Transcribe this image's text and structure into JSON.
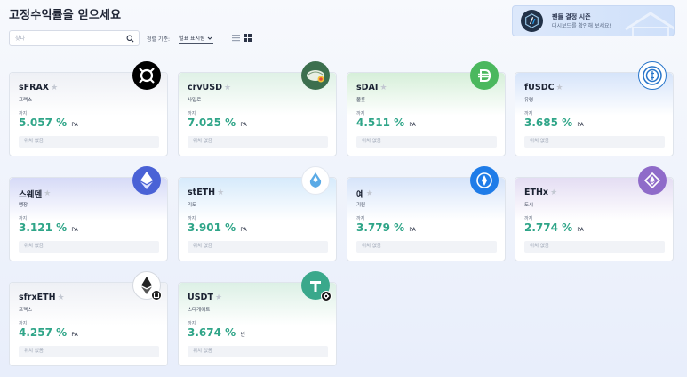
{
  "page": {
    "title": "고정수익률을 얻으세요"
  },
  "banner": {
    "title": "펜들 결정 시즌",
    "subtitle": "대시보드를 확인해 보세요!"
  },
  "toolbar": {
    "search_placeholder": "찾다",
    "sort_label": "정렬 기준:",
    "sort_value": "별표 표시됨"
  },
  "colors": {
    "rate_green": "#2fa588",
    "sfrax_head": "#eef0f5",
    "crvusd_head": "#dff1e6",
    "sdai_head": "#d9f0dd",
    "fusdc_head": "#d8e6fa",
    "weth_head": "#d9dcf7",
    "steth_head": "#d9ecfb",
    "usde_head": "#d8e6fa",
    "ethx_head": "#e6e0f3",
    "sfrxeth_head": "#eef0f5",
    "usdt_head": "#dff1e8"
  },
  "cards": [
    {
      "name": "sFRAX",
      "sub": "프랙스",
      "until": "까지",
      "rate": "5.057 %",
      "unit": "PA",
      "position": "위치 없음",
      "icon": "frax-icon",
      "badge": ""
    },
    {
      "name": "crvUSD",
      "sub": "사일로",
      "until": "까지",
      "rate": "7.025 %",
      "unit": "PA",
      "position": "위치 없음",
      "icon": "silo-icon",
      "badge": ""
    },
    {
      "name": "sDAI",
      "sub": "볼릇",
      "until": "까지",
      "rate": "4.511 %",
      "unit": "PA",
      "position": "위치 없음",
      "icon": "dai-icon",
      "badge": ""
    },
    {
      "name": "fUSDC",
      "sub": "유령",
      "until": "까지",
      "rate": "3.685 %",
      "unit": "PA",
      "position": "위치 없음",
      "icon": "usdc-icon",
      "badge": ""
    },
    {
      "name": "스웨덴",
      "sub": "맹장",
      "until": "까지",
      "rate": "3.121 %",
      "unit": "PA",
      "position": "위치 없음",
      "icon": "ethereum-icon",
      "badge": ""
    },
    {
      "name": "stETH",
      "sub": "리도",
      "until": "까지",
      "rate": "3.901 %",
      "unit": "PA",
      "position": "위치 없음",
      "icon": "lido-icon",
      "badge": ""
    },
    {
      "name": "예",
      "sub": "기원",
      "until": "까지",
      "rate": "3.779 %",
      "unit": "PA",
      "position": "위치 없음",
      "icon": "usde-icon",
      "badge": ""
    },
    {
      "name": "ETHx",
      "sub": "도시",
      "until": "까지",
      "rate": "2.774 %",
      "unit": "PA",
      "position": "위치 없음",
      "icon": "ethx-icon",
      "badge": ""
    },
    {
      "name": "sfrxETH",
      "sub": "프랙스",
      "until": "까지",
      "rate": "4.257 %",
      "unit": "PA",
      "position": "위치 없음",
      "icon": "sfrxeth-icon",
      "badge": "frax-badge-icon"
    },
    {
      "name": "USDT",
      "sub": "스타게이트",
      "until": "까지",
      "rate": "3.674 %",
      "unit": "년",
      "position": "위치 없음",
      "icon": "tether-icon",
      "badge": "stargate-badge-icon"
    }
  ]
}
